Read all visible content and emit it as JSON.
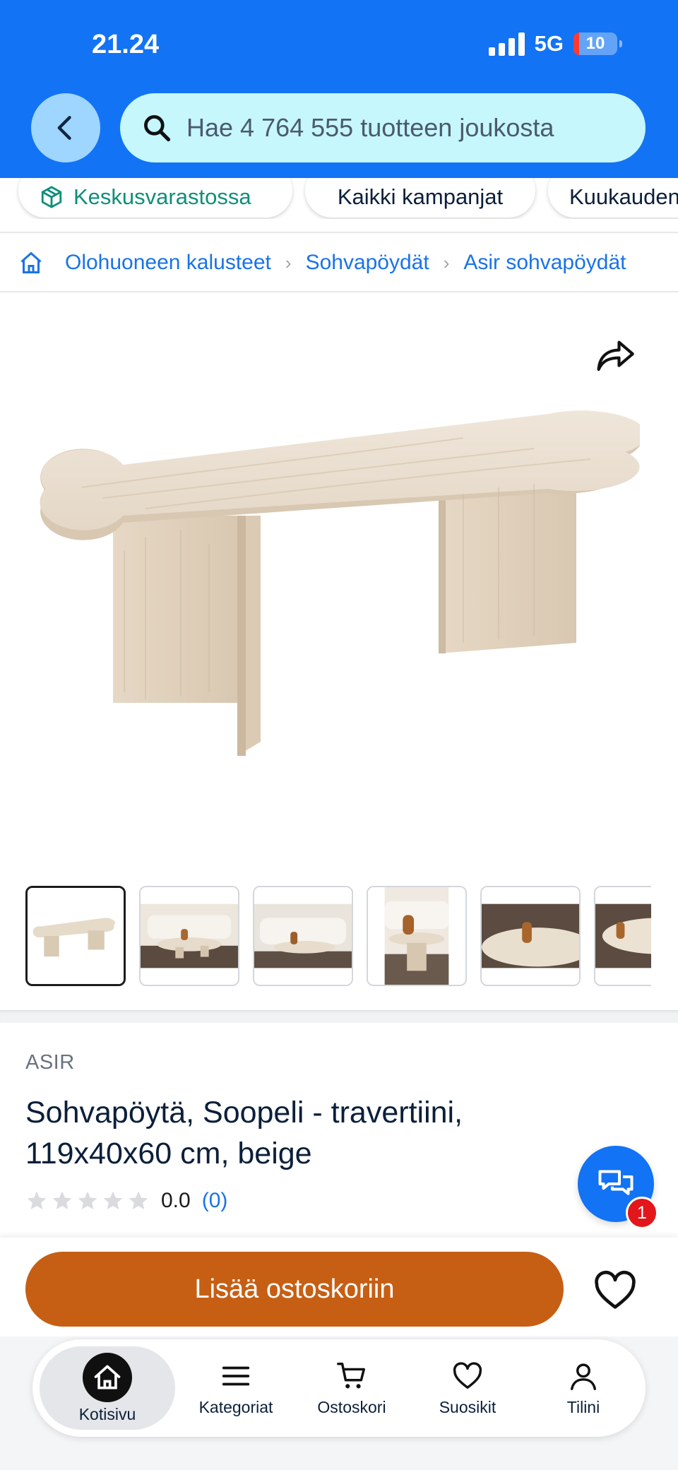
{
  "status_bar": {
    "time": "21.24",
    "network": "5G",
    "battery": "10"
  },
  "header": {
    "search": {
      "placeholder": "Hae 4 764 555 tuotteen joukosta"
    }
  },
  "chips": [
    "Keskusvarastossa",
    "Kaikki kampanjat",
    "Kuukauden"
  ],
  "breadcrumb": [
    "Olohuoneen kalusteet",
    "Sohvapöydät",
    "Asir sohvapöydät"
  ],
  "gallery": {
    "thumbnail_count": 6,
    "selected_index": 0
  },
  "product": {
    "brand": "ASIR",
    "title": "Sohvapöytä, Soopeli - travertiini, 119x40x60 cm, beige",
    "rating": {
      "value": "0.0",
      "count": "(0)",
      "stars_filled": 0,
      "stars_total": 5
    }
  },
  "chat": {
    "badge": "1"
  },
  "cta": {
    "add_to_cart": "Lisää ostoskoriin"
  },
  "tabbar": {
    "home": "Kotisivu",
    "categories": "Kategoriat",
    "cart": "Ostoskori",
    "favorites": "Suosikit",
    "account": "Tilini"
  },
  "colors": {
    "header_blue": "#1273f5",
    "search_bg": "#c6f7fd",
    "link_blue": "#1a73e8",
    "cta_orange": "#c65f14",
    "chip_green": "#0e8f7a",
    "badge_red": "#e2161b"
  }
}
